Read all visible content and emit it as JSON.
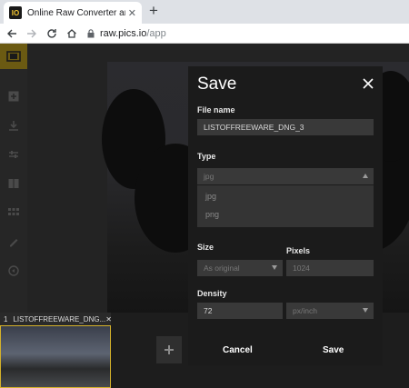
{
  "browser": {
    "tab_title": "Online Raw Converter and Viewer",
    "tab_icon_text": "IO",
    "url_domain": "raw.pics.io",
    "url_path": "/app"
  },
  "filmstrip": {
    "thumb_number": "1",
    "thumb_name": "LISTOFFREEWARE_DNG...",
    "thumb_close": "✕"
  },
  "save_dialog": {
    "title": "Save",
    "file_name_label": "File name",
    "file_name_value": "LISTOFFREEWARE_DNG_3",
    "type_label": "Type",
    "type_value": "jpg",
    "type_options": [
      "jpg",
      "png"
    ],
    "size_label": "Size",
    "size_value": "As original",
    "pixels_label": "Pixels",
    "pixels_value": "1024",
    "density_label": "Density",
    "density_value": "72",
    "density_unit": "px/inch",
    "cancel_label": "Cancel",
    "save_label": "Save"
  },
  "colors": {
    "accent": "#d4b12a",
    "dialog_bg": "#1b1b1b",
    "field_bg": "#393939"
  }
}
